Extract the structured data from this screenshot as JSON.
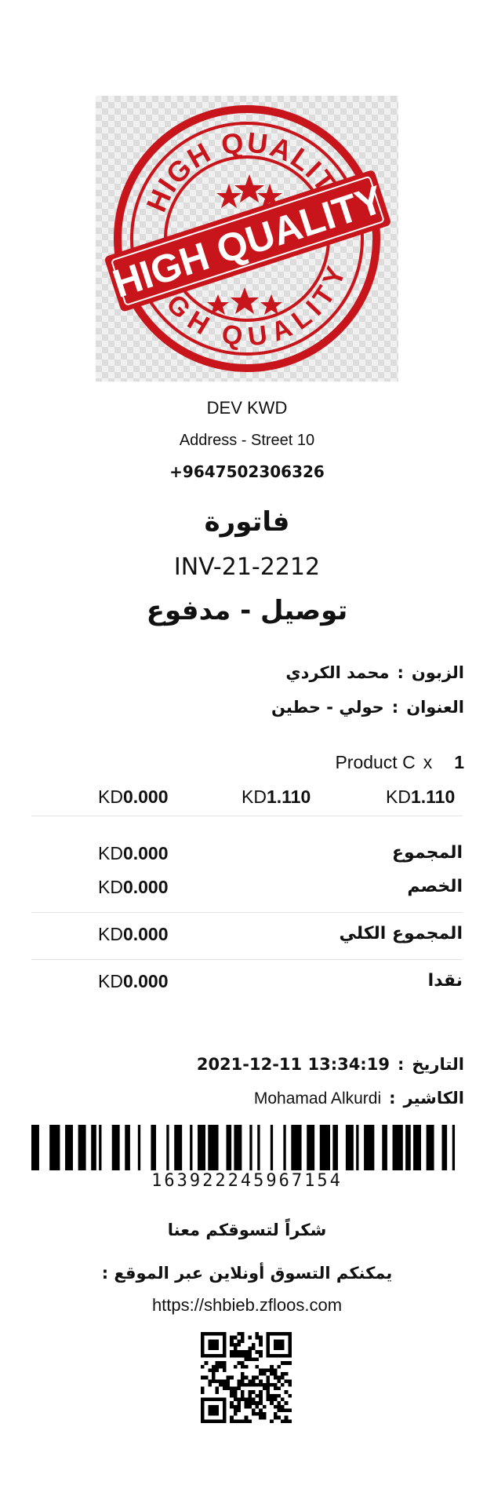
{
  "logo": {
    "text_top": "HIGH QUALITY",
    "text_center": "HIGH QUALITY",
    "text_bottom": "HIGH QUALITY",
    "color": "#c8141b"
  },
  "store": {
    "name": "DEV KWD",
    "address": "Address - Street 10",
    "phone": "+9647502306326"
  },
  "invoice": {
    "title": "فاتورة",
    "number": "INV-21-2212",
    "status": "توصيل - مدفوع"
  },
  "customer": {
    "label": "الزبون",
    "value": "محمد الكردي"
  },
  "address_row": {
    "label": "العنوان",
    "value": "حولي - حطين"
  },
  "separator": ":",
  "items": [
    {
      "name": "Product C",
      "mult": "x",
      "qty": "1",
      "price_currency": "KD",
      "price": "1.110",
      "total_currency": "KD",
      "total": "1.110",
      "extra_currency": "KD",
      "extra": "0.000"
    }
  ],
  "totals": {
    "subtotal": {
      "label": "المجموع",
      "currency": "KD",
      "value": "0.000"
    },
    "discount": {
      "label": "الخصم",
      "currency": "KD",
      "value": "0.000"
    },
    "grand_total": {
      "label": "المجموع الكلي",
      "currency": "KD",
      "value": "0.000"
    },
    "cash": {
      "label": "نقدا",
      "currency": "KD",
      "value": "0.000"
    }
  },
  "date_row": {
    "label": "التاريخ",
    "value": "2021-12-11 13:34:19"
  },
  "cashier_row": {
    "label": "الكاشير",
    "value": "Mohamad Alkurdi"
  },
  "barcode": {
    "number": "163922245967154"
  },
  "footer": {
    "thanks": "شكراً لتسوقكم معنا",
    "online": "يمكنكم التسوق أونلاين عبر الموقع :",
    "url": "https://shbieb.zfloos.com"
  }
}
